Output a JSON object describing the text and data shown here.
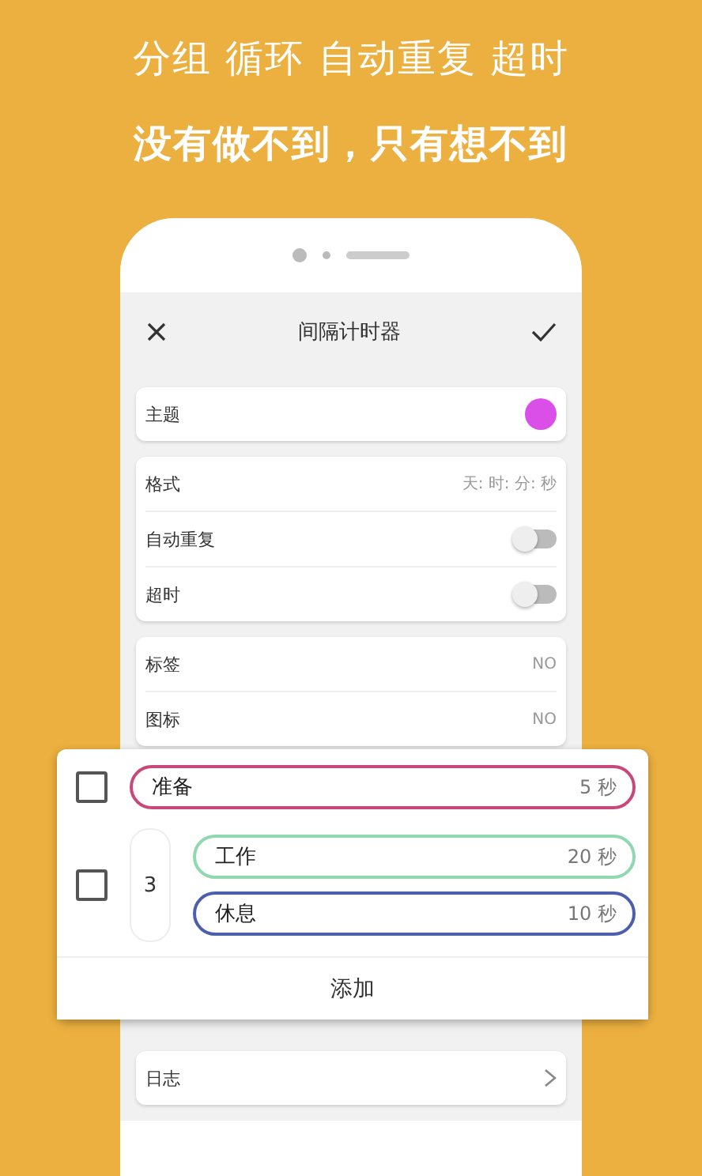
{
  "headline": [
    "分组 循环 自动重复 超时",
    "没有做不到，只有想不到"
  ],
  "app_bar": {
    "title": "间隔计时器"
  },
  "theme": {
    "label": "主题",
    "color": "#d94fe8"
  },
  "settings": [
    {
      "kind": "value",
      "label": "格式",
      "value": "天: 时: 分: 秒"
    },
    {
      "kind": "toggle",
      "label": "自动重复",
      "on": false
    },
    {
      "kind": "toggle",
      "label": "超时",
      "on": false
    }
  ],
  "options": [
    {
      "label": "标签",
      "value": "NO"
    },
    {
      "label": "图标",
      "value": "NO"
    }
  ],
  "groups": [
    {
      "checked": false,
      "steps": [
        {
          "name": "准备",
          "duration": "5 秒",
          "color": "#c9487a"
        }
      ]
    },
    {
      "checked": false,
      "repeat": "3",
      "steps": [
        {
          "name": "工作",
          "duration": "20 秒",
          "color": "#8fd8b0"
        },
        {
          "name": "休息",
          "duration": "10 秒",
          "color": "#4b5fae"
        }
      ]
    }
  ],
  "add_button": "添加",
  "log": {
    "label": "日志"
  }
}
